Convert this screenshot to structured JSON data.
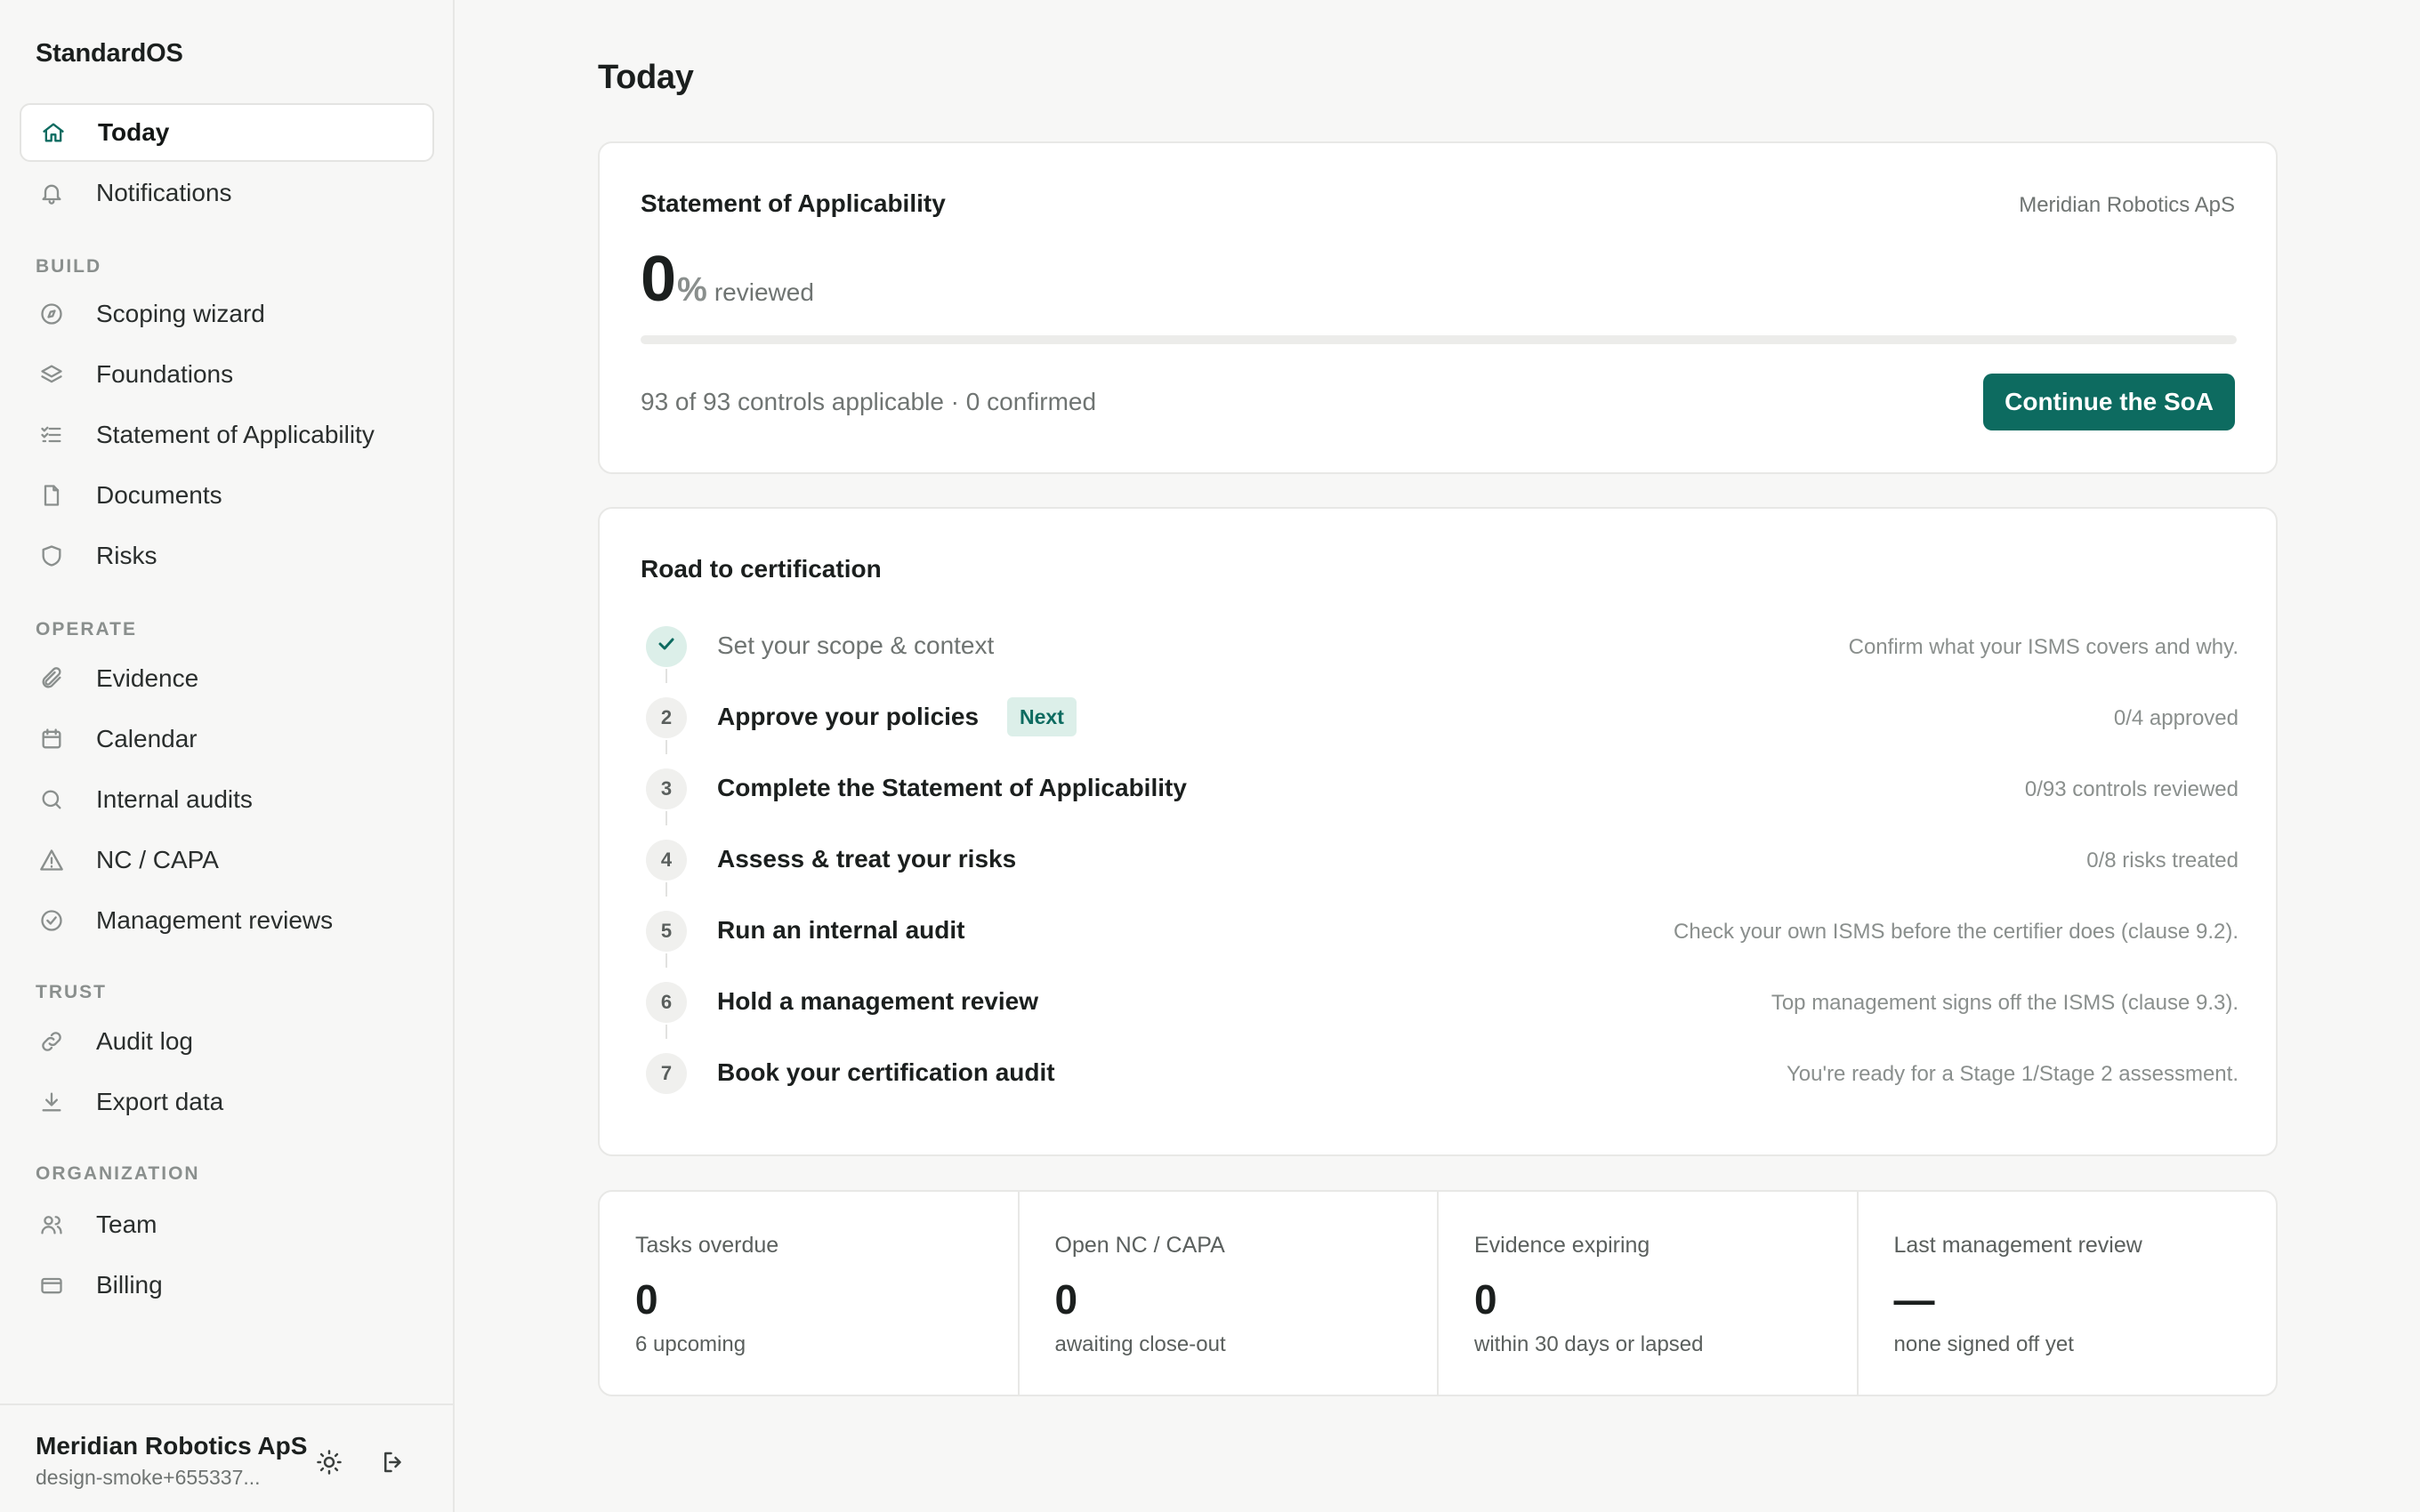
{
  "app": {
    "brand": "StandardOS"
  },
  "sidebar": {
    "top_items": [
      {
        "label": "Today",
        "icon": "home-icon",
        "active": true
      },
      {
        "label": "Notifications",
        "icon": "bell-icon"
      }
    ],
    "sections": [
      {
        "label": "BUILD",
        "items": [
          {
            "label": "Scoping wizard",
            "icon": "compass-icon"
          },
          {
            "label": "Foundations",
            "icon": "layers-icon"
          },
          {
            "label": "Statement of Applicability",
            "icon": "checklist-icon"
          },
          {
            "label": "Documents",
            "icon": "document-icon"
          },
          {
            "label": "Risks",
            "icon": "shield-icon"
          }
        ]
      },
      {
        "label": "OPERATE",
        "items": [
          {
            "label": "Evidence",
            "icon": "paperclip-icon"
          },
          {
            "label": "Calendar",
            "icon": "calendar-icon"
          },
          {
            "label": "Internal audits",
            "icon": "search-icon"
          },
          {
            "label": "NC / CAPA",
            "icon": "warning-icon"
          },
          {
            "label": "Management reviews",
            "icon": "check-circle-icon"
          }
        ]
      },
      {
        "label": "TRUST",
        "items": [
          {
            "label": "Audit log",
            "icon": "link-icon"
          },
          {
            "label": "Export data",
            "icon": "download-icon"
          }
        ]
      },
      {
        "label": "ORGANIZATION",
        "items": [
          {
            "label": "Team",
            "icon": "users-icon"
          },
          {
            "label": "Billing",
            "icon": "credit-card-icon"
          }
        ]
      }
    ],
    "user": {
      "name": "Meridian Robotics ApS",
      "email": "design-smoke+655337...",
      "theme_icon": "sun-icon",
      "logout_icon": "logout-icon"
    }
  },
  "main": {
    "title": "Today",
    "soa": {
      "title": "Statement of Applicability",
      "org": "Meridian Robotics ApS",
      "percent": "0",
      "percent_symbol": "%",
      "reviewed_label": "reviewed",
      "progress": 0,
      "summary": "93 of 93 controls applicable · 0 confirmed",
      "cta": "Continue the SoA",
      "accent": "#0d6b60"
    },
    "road": {
      "title": "Road to certification",
      "steps": [
        {
          "num": "1",
          "label": "Set your scope & context",
          "meta": "Confirm what your ISMS covers and why.",
          "done": true
        },
        {
          "num": "2",
          "label": "Approve your policies",
          "meta": "0/4 approved",
          "badge": "Next"
        },
        {
          "num": "3",
          "label": "Complete the Statement of Applicability",
          "meta": "0/93 controls reviewed"
        },
        {
          "num": "4",
          "label": "Assess & treat your risks",
          "meta": "0/8 risks treated"
        },
        {
          "num": "5",
          "label": "Run an internal audit",
          "meta": "Check your own ISMS before the certifier does (clause 9.2)."
        },
        {
          "num": "6",
          "label": "Hold a management review",
          "meta": "Top management signs off the ISMS (clause 9.3)."
        },
        {
          "num": "7",
          "label": "Book your certification audit",
          "meta": "You're ready for a Stage 1/Stage 2 assessment."
        }
      ]
    },
    "stats": [
      {
        "label": "Tasks overdue",
        "value": "0",
        "sub": "6 upcoming"
      },
      {
        "label": "Open NC / CAPA",
        "value": "0",
        "sub": "awaiting close-out"
      },
      {
        "label": "Evidence expiring",
        "value": "0",
        "sub": "within 30 days or lapsed"
      },
      {
        "label": "Last management review",
        "value": "—",
        "sub": "none signed off yet"
      }
    ]
  }
}
